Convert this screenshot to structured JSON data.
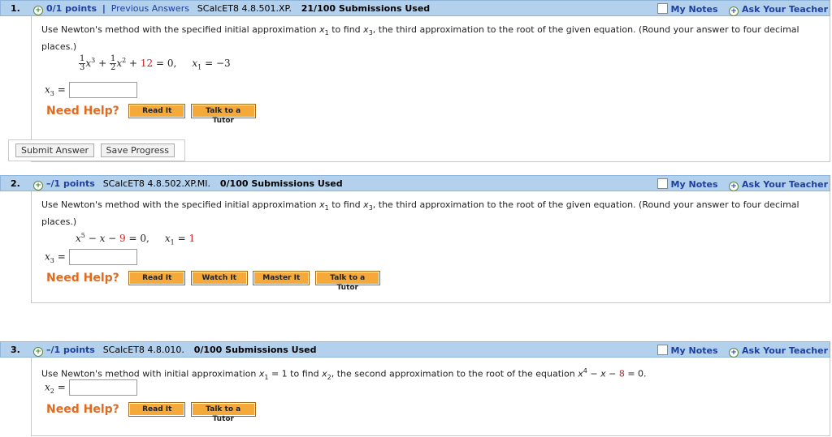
{
  "q1": {
    "number": "1.",
    "points": "0/1 points",
    "sep": "|",
    "previous": "Previous Answers",
    "code": "SCalcET8 4.8.501.XP.",
    "submissions": "21/100 Submissions Used",
    "my_notes": "My Notes",
    "ask_teacher": "Ask Your Teacher",
    "prompt_a": "Use Newton's method with the specified initial approximation ",
    "prompt_b": " to find ",
    "prompt_c": ", the third approximation to the root of the given equation. (Round your answer to four decimal places.)",
    "x1_var": "x",
    "x3_var": "x",
    "eq_const": "12",
    "eq_x1_value": "= −3",
    "answer_label": "x",
    "answer_value": "",
    "help_label": "Need Help?",
    "buttons": [
      "Read It",
      "Talk to a Tutor"
    ],
    "submit": "Submit Answer",
    "save": "Save Progress"
  },
  "q2": {
    "number": "2.",
    "points": "–/1 points",
    "code": "SCalcET8 4.8.502.XP.MI.",
    "submissions": "0/100 Submissions Used",
    "my_notes": "My Notes",
    "ask_teacher": "Ask Your Teacher",
    "prompt_a": "Use Newton's method with the specified initial approximation ",
    "prompt_b": " to find ",
    "prompt_c": ", the third approximation to the root of the given equation. (Round your answer to four decimal places.)",
    "eq_const": "9",
    "x1_value": "1",
    "answer_value": "",
    "help_label": "Need Help?",
    "buttons": [
      "Read It",
      "Watch It",
      "Master It",
      "Talk to a Tutor"
    ]
  },
  "q3": {
    "number": "3.",
    "points": "–/1 points",
    "code": "SCalcET8 4.8.010.",
    "submissions": "0/100 Submissions Used",
    "my_notes": "My Notes",
    "ask_teacher": "Ask Your Teacher",
    "prompt_a": "Use Newton's method with initial approximation ",
    "prompt_b": " to find ",
    "prompt_c": ", the second approximation to the root of the equation ",
    "eq_const": "8",
    "answer_value": "",
    "help_label": "Need Help?",
    "buttons": [
      "Read It",
      "Talk to a Tutor"
    ]
  },
  "colors": {
    "bar": "#b3d0ec",
    "link": "#1f3f9f",
    "help": "#e06a20",
    "button": "#f6a93b",
    "red": "#cc2222"
  }
}
